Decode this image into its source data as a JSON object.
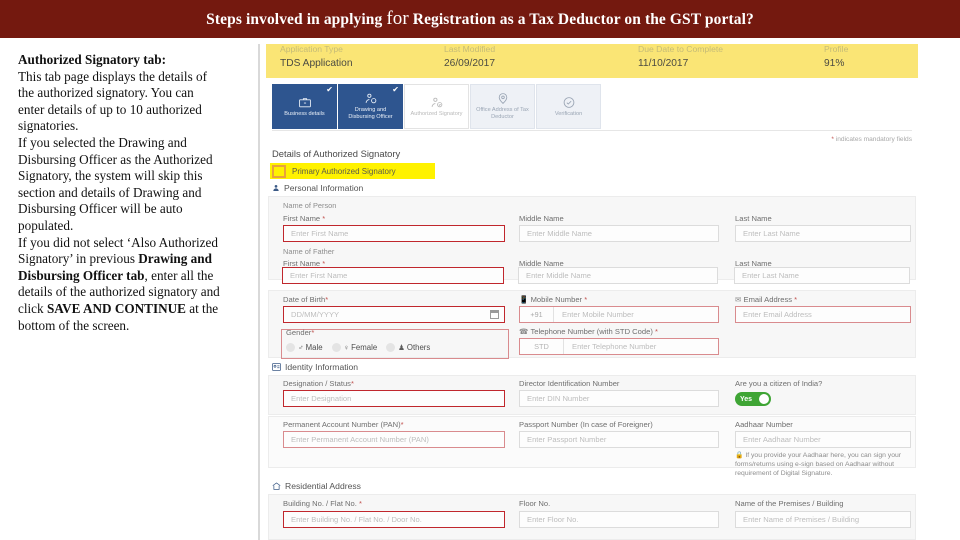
{
  "slide": {
    "title_lead": "Steps involved in applying ",
    "title_big": "for",
    "title_rest": " Registration as a Tax Deductor on the GST portal?",
    "header_bg": "#74190F"
  },
  "narrative": {
    "heading": "Authorized Signatory tab:",
    "para1": "This tab page displays the details of the authorized signatory. You can enter details of up to 10 authorized signatories.",
    "para2_a": "If you selected the Drawing and Disbursing Officer as the Authorized Signatory, the system will skip this section and details of Drawing and Disbursing Officer will be auto populated.",
    "para3_a": "If you did not select ‘Also Authorized Signatory’ in previous ",
    "para3_bold1": "Drawing and Disbursing Officer tab",
    "para3_b": ", enter all the details of the authorized signatory and click ",
    "para3_bold2": "SAVE AND CONTINUE",
    "para3_c": " at the bottom of the screen."
  },
  "banner": {
    "headers": [
      "Application Type",
      "Last Modified",
      "Due Date to Complete",
      "Profile"
    ],
    "values": [
      "TDS Application",
      "26/09/2017",
      "11/10/2017",
      "91%"
    ],
    "bg": "#FAE575"
  },
  "tabs": [
    {
      "label": "Business details",
      "state": "done",
      "icon": "briefcase-icon"
    },
    {
      "label": "Drawing and Disbursing Officer",
      "state": "done",
      "icon": "user-badge-icon"
    },
    {
      "label": "Authorized Signatory",
      "state": "active",
      "icon": "user-check-icon"
    },
    {
      "label": "Office Address of Tax Deductor",
      "state": "todo",
      "icon": "map-pin-icon"
    },
    {
      "label": "Verification",
      "state": "todo",
      "icon": "check-circle-icon"
    }
  ],
  "mandatory_note": "indicates mandatory fields",
  "details": {
    "title": "Details of Authorized Signatory",
    "primary_checkbox_label": "Primary Authorized Signatory"
  },
  "personal": {
    "heading": "Personal Information",
    "group_person": "Name of Person",
    "group_father": "Name of Father",
    "person": [
      {
        "label": "First Name",
        "required": true,
        "placeholder": "Enter First Name"
      },
      {
        "label": "Middle Name",
        "required": false,
        "placeholder": "Enter Middle Name"
      },
      {
        "label": "Last Name",
        "required": false,
        "placeholder": "Enter Last Name"
      }
    ],
    "father": [
      {
        "label": "First Name",
        "required": true,
        "placeholder": "Enter First Name"
      },
      {
        "label": "Middle Name",
        "required": false,
        "placeholder": "Enter Middle Name"
      },
      {
        "label": "Last Name",
        "required": false,
        "placeholder": "Enter Last Name"
      }
    ],
    "dob_label": "Date of Birth",
    "dob_placeholder": "DD/MM/YYYY",
    "mobile_label": "Mobile Number",
    "mobile_prefix": "+91",
    "mobile_placeholder": "Enter Mobile Number",
    "email_label": "Email Address",
    "email_placeholder": "Enter Email Address",
    "gender_label": "Gender",
    "gender_options": [
      "Male",
      "Female",
      "Others"
    ],
    "telephone_label": "Telephone Number (with STD Code)",
    "telephone_std": "STD",
    "telephone_placeholder": "Enter Telephone Number"
  },
  "identity": {
    "heading": "Identity Information",
    "designation_label": "Designation / Status",
    "designation_placeholder": "Enter Designation",
    "din_label": "Director Identification Number",
    "din_placeholder": "Enter DIN Number",
    "citizen_label": "Are you a citizen of India?",
    "citizen_toggle": "Yes",
    "citizen_color": "#3FA535",
    "pan_label": "Permanent Account Number (PAN)",
    "pan_placeholder": "Enter Permanent Account Number (PAN)",
    "passport_label": "Passport Number (In case of Foreigner)",
    "passport_placeholder": "Enter Passport Number",
    "aadhaar_label": "Aadhaar Number",
    "aadhaar_placeholder": "Enter Aadhaar Number",
    "aadhaar_note": "If you provide your Aadhaar here, you can sign your forms/returns using e-sign based on Aadhaar without requirement of Digital Signature."
  },
  "residential": {
    "heading": "Residential Address",
    "building_label": "Building No. / Flat No.",
    "building_placeholder": "Enter Building No. / Flat No. / Door No.",
    "floor_label": "Floor No.",
    "floor_placeholder": "Enter Floor No.",
    "premises_label": "Name of the Premises / Building",
    "premises_placeholder": "Enter Name of Premises / Building"
  }
}
